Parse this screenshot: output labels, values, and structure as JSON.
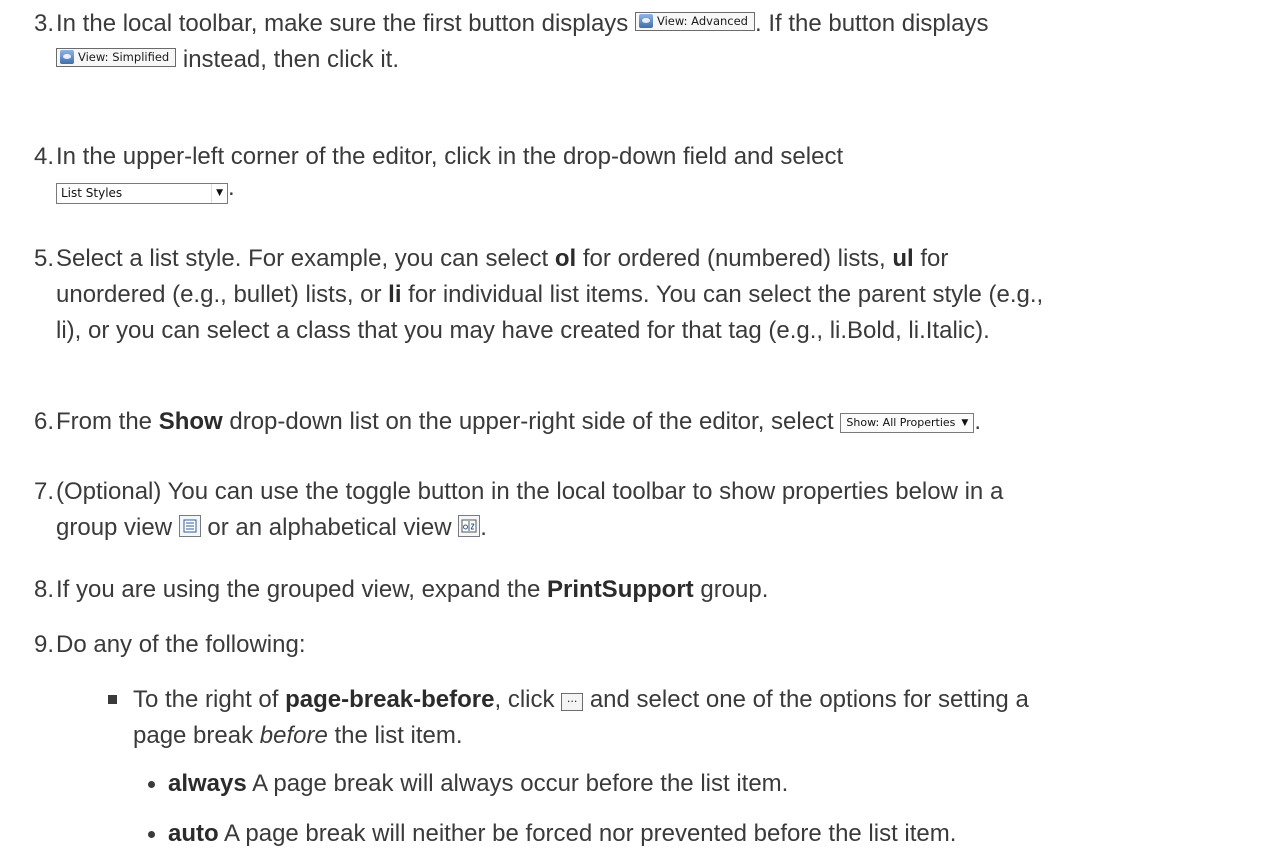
{
  "steps": [
    {
      "num": "3.",
      "t1": "In the local toolbar, make sure the first button displays",
      "t2": ". If the button displays",
      "t3": "instead, then click it.",
      "btn_advanced": "View: Advanced",
      "btn_simplified": "View: Simplified"
    },
    {
      "num": "4.",
      "t1": "In the upper-left corner of the editor, click in the drop-down field and select",
      "combo": "List Styles",
      "t2": "."
    },
    {
      "num": "5.",
      "t1": "Select a list style. For example, you can select ",
      "k1": "ol",
      "t2": " for ordered (numbered) lists, ",
      "k2": "ul",
      "t3": " for",
      "t4": "unordered (e.g., bullet) lists, or ",
      "k3": "li",
      "t5": " for individual list items. You can select the parent style (e.g.,",
      "t6": "li), or you can select a class that you may have created for that tag (e.g., li.Bold, li.Italic)."
    },
    {
      "num": "6.",
      "t1": "From the ",
      "k1": "Show",
      "t2": " drop-down list on the upper-right side of the editor, select",
      "show_btn": "Show: All Properties",
      "t3": "."
    },
    {
      "num": "7.",
      "t1": "(Optional) You can use the toggle button in the local toolbar to show properties below in a",
      "t2": "group view",
      "t3": " or an alphabetical view",
      "t4": "."
    },
    {
      "num": "8.",
      "t1": "If you are using the grouped view, expand the ",
      "k1": "PrintSupport",
      "t2": " group."
    },
    {
      "num": "9.",
      "t1": "Do any of the following:"
    }
  ],
  "sub": {
    "t1": "To the right of ",
    "k1": "page-break-before",
    "t2": ", click",
    "t3": " and select one of the options for setting a",
    "t4": "page break ",
    "em": "before",
    "t5": " the list item.",
    "ellipsis": "···"
  },
  "options": [
    {
      "k": "always",
      "t": " A page break will always occur before the list item."
    },
    {
      "k": "auto",
      "t": " A page break will neither be forced nor prevented before the list item."
    }
  ],
  "icons": {
    "view_button": "eye-view-icon",
    "group_view": "group-view-icon",
    "alpha_view": "alphabetical-view-icon",
    "dropdown_arrow": "▼"
  }
}
